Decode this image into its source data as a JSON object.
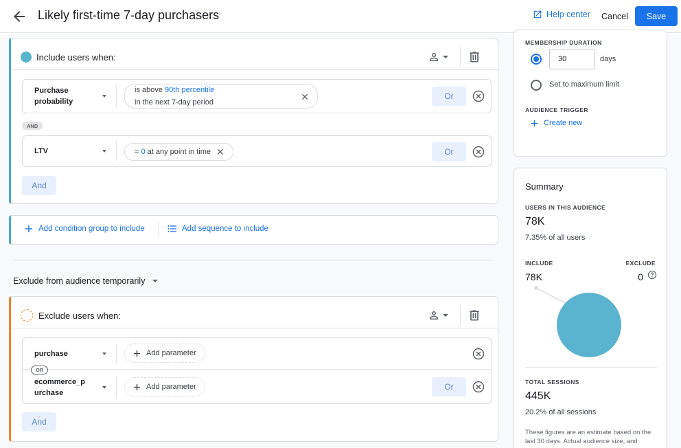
{
  "header": {
    "title": "Likely first-time 7-day purchasers",
    "help_center": "Help center",
    "cancel": "Cancel",
    "save": "Save",
    "accent": "#1a73e8"
  },
  "include_group": {
    "title": "Include users when:",
    "accent": "#4fa8c7",
    "conditions": [
      {
        "dimension_line1": "Purchase",
        "dimension_line2": "probability",
        "chip_prefix": "is above ",
        "chip_value": "90th percentile",
        "chip_line2": "in the next 7-day period",
        "or_label": "Or"
      },
      {
        "dimension_line1": "LTV",
        "chip_prefix": "= ",
        "chip_value": "0",
        "chip_suffix": " at any point in time",
        "or_label": "Or"
      }
    ],
    "and_badge": "AND",
    "and_button": "And"
  },
  "add_actions": {
    "add_condition_group": "Add condition group to include",
    "add_sequence": "Add sequence to include"
  },
  "exclude_section": {
    "title": "Exclude from audience temporarily"
  },
  "exclude_group": {
    "title": "Exclude users when:",
    "accent": "#e8862e",
    "conditions": [
      {
        "dimension_line1": "purchase",
        "add_parameter": "Add parameter"
      },
      {
        "dimension_line1": "ecommerce_p",
        "dimension_line2": "urchase",
        "add_parameter": "Add parameter",
        "or_label": "Or"
      }
    ],
    "or_badge": "OR",
    "and_button": "And"
  },
  "membership": {
    "caption": "MEMBERSHIP DURATION",
    "days_value": "30",
    "days_unit": "days",
    "max_limit": "Set to maximum limit",
    "trigger_caption": "AUDIENCE TRIGGER",
    "create_new": "Create new"
  },
  "summary": {
    "title": "Summary",
    "users_caption": "USERS IN THIS AUDIENCE",
    "users_value": "78K",
    "users_pct": "7.35% of all users",
    "include_caption": "INCLUDE",
    "exclude_caption": "EXCLUDE",
    "include_value": "78K",
    "exclude_value": "0",
    "pie_color": "#5bb4cf",
    "sessions_caption": "TOTAL SESSIONS",
    "sessions_value": "445K",
    "sessions_pct": "20.2% of all sessions",
    "note": "These figures are an estimate based on the last 30 days. Actual audience size, and"
  }
}
